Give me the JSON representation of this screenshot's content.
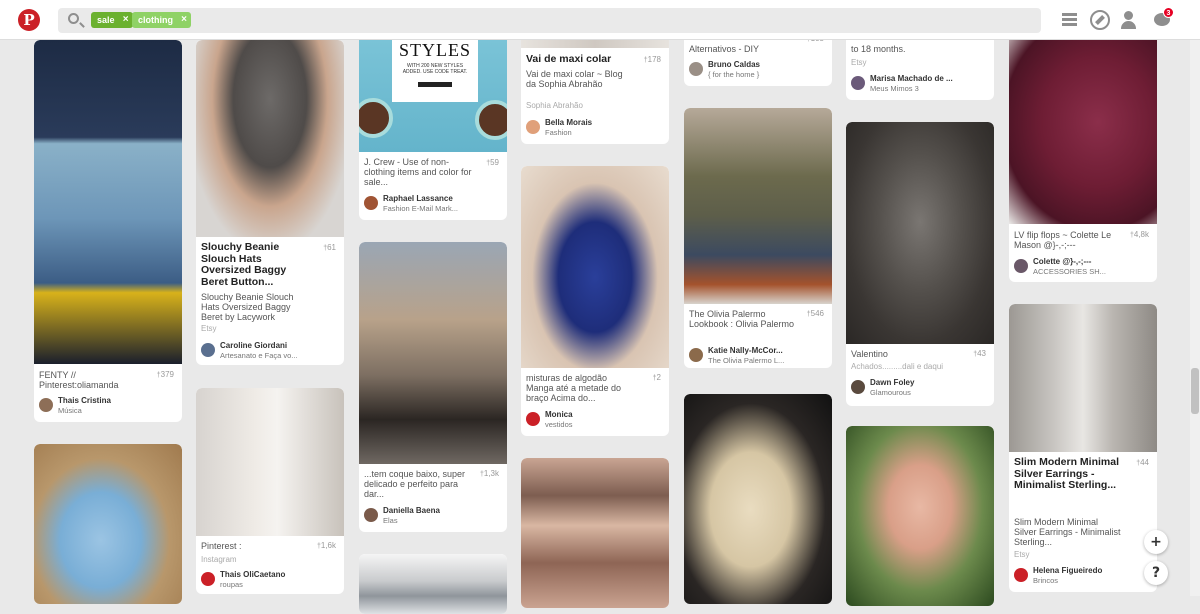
{
  "header": {
    "logo": "P",
    "chips": [
      {
        "label": "sale",
        "remove": "×"
      },
      {
        "label": "clothing",
        "remove": "×"
      }
    ],
    "notification_count": "3"
  },
  "fabs": {
    "add": "+",
    "help": "?"
  },
  "pins": [
    {
      "desc": "FENTY // Pinterest:oliamanda",
      "count": "379",
      "user": "Thais Cristina",
      "board": "Música"
    },
    {
      "title": "Slouchy Beanie Slouch Hats Oversized Baggy Beret Button...",
      "count": "61",
      "desc": "Slouchy Beanie Slouch Hats Oversized Baggy Beret by Lacywork",
      "source": "Etsy",
      "user": "Caroline Giordani",
      "board": "Artesanato e Faça vo..."
    },
    {
      "desc": "Pinterest :",
      "count": "1,6k",
      "source": "Instagram",
      "user": "Thais OliCaetano",
      "board": "roupas"
    },
    {
      "banner_title": "STYLES",
      "banner_sub": "WITH 200 NEW STYLES ADDED. USE CODE TREAT.",
      "desc": "J. Crew - Use of non-clothing items and color for sale...",
      "count": "59",
      "user": "Raphael Lassance",
      "board": "Fashion E-Mail Mark..."
    },
    {
      "desc": "...tem coque baixo, super delicado e perfeito para dar...",
      "count": "1,3k",
      "user": "Daniella Baena",
      "board": "Elas"
    },
    {
      "title": "Vai de maxi colar",
      "count": "178",
      "desc": "Vai de maxi colar ~ Blog da Sophia Abrahão",
      "source": "Sophia Abrahão",
      "user": "Bella Morais",
      "board": "Fashion"
    },
    {
      "desc": "misturas de algodão Manga até a metade do braço Acima do...",
      "count": "2",
      "user": "Monica",
      "board": "vestidos"
    },
    {
      "desc": "Alternativos - DIY",
      "count": "105",
      "user": "Bruno Caldas",
      "board": "{ for the home }"
    },
    {
      "desc": "The Olivia Palermo Lookbook : Olivia Palermo",
      "count": "546",
      "user": "Katie Nally-McCor...",
      "board": "The Olivia Palermo L..."
    },
    {
      "desc": "to 18 months.",
      "source": "Etsy",
      "user": "Marisa Machado de ...",
      "board": "Meus Mimos 3"
    },
    {
      "desc": "Valentino",
      "count": "43",
      "source": "Achados.........dali e daqui",
      "user": "Dawn Foley",
      "board": "Glamourous"
    },
    {
      "desc": "LV flip flops ~ Colette Le Mason @}-,-;---",
      "count": "4,8k",
      "user": "Colette @}-,-;---",
      "board": "ACCESSORIES SH..."
    },
    {
      "title": "Slim Modern Minimal Silver Earrings - Minimalist Sterling...",
      "count": "44",
      "desc": "Slim Modern Minimal Silver Earrings - Minimalist Sterling...",
      "source": "Etsy",
      "user": "Helena Figueiredo",
      "board": "Brincos"
    }
  ]
}
